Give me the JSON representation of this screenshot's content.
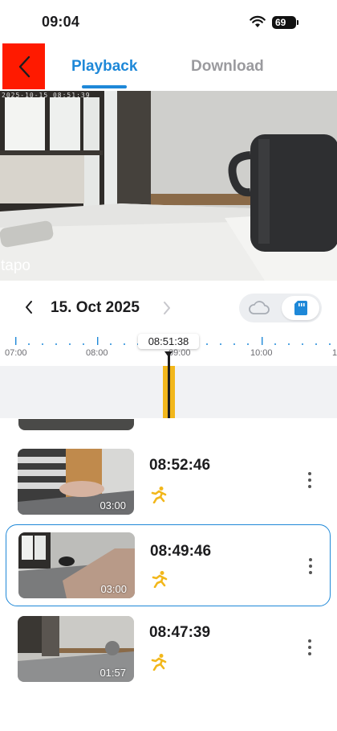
{
  "status_bar": {
    "time": "09:04",
    "battery": "69"
  },
  "header": {
    "tabs": {
      "playback": "Playback",
      "download": "Download"
    }
  },
  "video": {
    "timestamp": "2025-10-15 08:51:39",
    "logo": "tapo"
  },
  "date_nav": {
    "date": "15. Oct 2025"
  },
  "timeline": {
    "current_time": "08:51:38",
    "tick_labels": [
      "07:00",
      "08:00",
      "09:00",
      "10:00",
      "1"
    ]
  },
  "recordings": [
    {
      "time": "08:52:46",
      "duration": "03:00",
      "event_icon": "motion-icon",
      "selected": false
    },
    {
      "time": "08:49:46",
      "duration": "03:00",
      "event_icon": "motion-icon",
      "selected": true
    },
    {
      "time": "08:47:39",
      "duration": "01:57",
      "event_icon": "motion-icon",
      "selected": false
    }
  ],
  "colors": {
    "accent": "#1e88d8",
    "recording": "#f2b71b",
    "back_highlight": "#ff1a00"
  }
}
